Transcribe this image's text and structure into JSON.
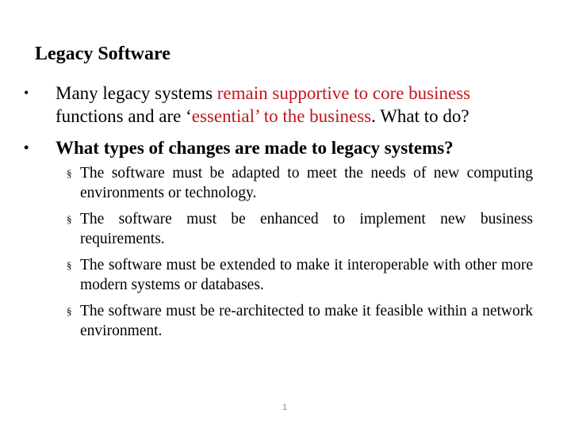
{
  "slide": {
    "title": "Legacy Software",
    "bullets": [
      {
        "marker": "•",
        "parts": [
          {
            "text": "Many legacy systems ",
            "style": "normal"
          },
          {
            "text": "remain supportive to core business functions and are ‘essential’ to the business",
            "style": "red"
          },
          {
            "text": ". What to do?",
            "style": "normal"
          }
        ],
        "line1_a": "Many legacy systems ",
        "line1_b": "remain supportive to core business",
        "line2_a": "functions and are ‘",
        "line2_b": "essential’ to the business",
        "line2_c": ". What to do?"
      },
      {
        "marker": "•",
        "text": "What types of changes are made to legacy systems?"
      }
    ],
    "sub_bullets": [
      {
        "marker": "§",
        "text": "The software must be adapted to meet the needs of new computing environments or technology."
      },
      {
        "marker": "§",
        "text": "The software must be enhanced to implement new business requirements."
      },
      {
        "marker": "§",
        "text": "The software must be extended to make it interoperable with other more modern systems or databases."
      },
      {
        "marker": "§",
        "text": "The software must be re-architected to make it feasible within a network environment."
      }
    ],
    "page_number": "1",
    "colors": {
      "accent_red": "#c0161b",
      "text": "#000000",
      "page_number": "#8a8a8a"
    }
  }
}
